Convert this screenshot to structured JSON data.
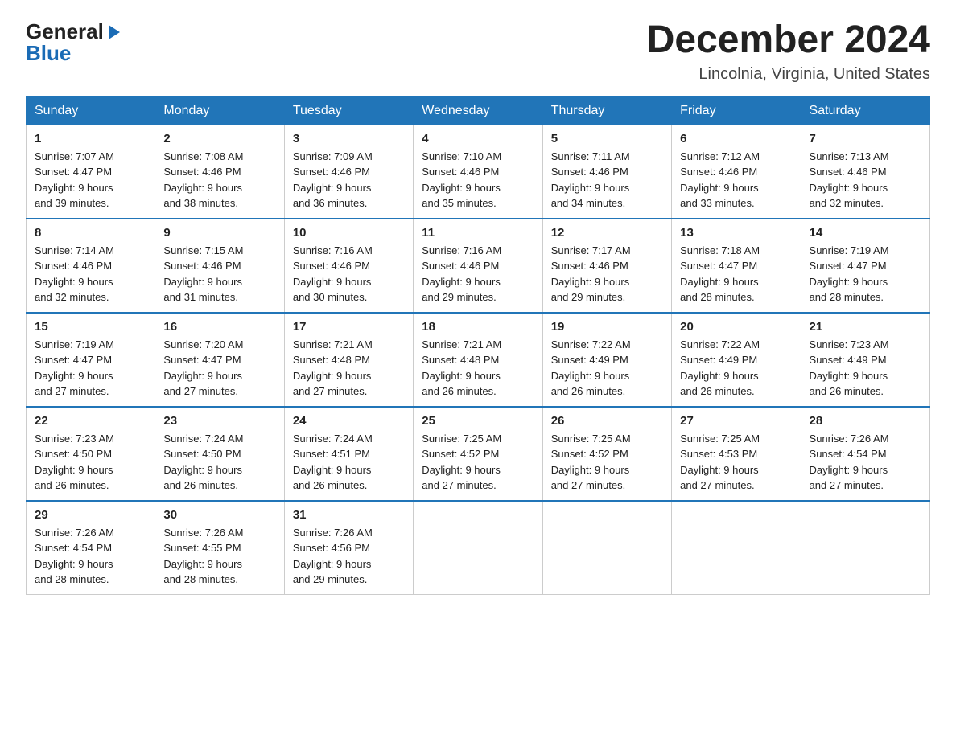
{
  "logo": {
    "text_general": "General",
    "text_blue": "Blue",
    "arrow": "▶"
  },
  "title": {
    "month_year": "December 2024",
    "location": "Lincolnia, Virginia, United States"
  },
  "days_of_week": [
    "Sunday",
    "Monday",
    "Tuesday",
    "Wednesday",
    "Thursday",
    "Friday",
    "Saturday"
  ],
  "weeks": [
    [
      {
        "num": "1",
        "sunrise": "7:07 AM",
        "sunset": "4:47 PM",
        "daylight": "9 hours and 39 minutes."
      },
      {
        "num": "2",
        "sunrise": "7:08 AM",
        "sunset": "4:46 PM",
        "daylight": "9 hours and 38 minutes."
      },
      {
        "num": "3",
        "sunrise": "7:09 AM",
        "sunset": "4:46 PM",
        "daylight": "9 hours and 36 minutes."
      },
      {
        "num": "4",
        "sunrise": "7:10 AM",
        "sunset": "4:46 PM",
        "daylight": "9 hours and 35 minutes."
      },
      {
        "num": "5",
        "sunrise": "7:11 AM",
        "sunset": "4:46 PM",
        "daylight": "9 hours and 34 minutes."
      },
      {
        "num": "6",
        "sunrise": "7:12 AM",
        "sunset": "4:46 PM",
        "daylight": "9 hours and 33 minutes."
      },
      {
        "num": "7",
        "sunrise": "7:13 AM",
        "sunset": "4:46 PM",
        "daylight": "9 hours and 32 minutes."
      }
    ],
    [
      {
        "num": "8",
        "sunrise": "7:14 AM",
        "sunset": "4:46 PM",
        "daylight": "9 hours and 32 minutes."
      },
      {
        "num": "9",
        "sunrise": "7:15 AM",
        "sunset": "4:46 PM",
        "daylight": "9 hours and 31 minutes."
      },
      {
        "num": "10",
        "sunrise": "7:16 AM",
        "sunset": "4:46 PM",
        "daylight": "9 hours and 30 minutes."
      },
      {
        "num": "11",
        "sunrise": "7:16 AM",
        "sunset": "4:46 PM",
        "daylight": "9 hours and 29 minutes."
      },
      {
        "num": "12",
        "sunrise": "7:17 AM",
        "sunset": "4:46 PM",
        "daylight": "9 hours and 29 minutes."
      },
      {
        "num": "13",
        "sunrise": "7:18 AM",
        "sunset": "4:47 PM",
        "daylight": "9 hours and 28 minutes."
      },
      {
        "num": "14",
        "sunrise": "7:19 AM",
        "sunset": "4:47 PM",
        "daylight": "9 hours and 28 minutes."
      }
    ],
    [
      {
        "num": "15",
        "sunrise": "7:19 AM",
        "sunset": "4:47 PM",
        "daylight": "9 hours and 27 minutes."
      },
      {
        "num": "16",
        "sunrise": "7:20 AM",
        "sunset": "4:47 PM",
        "daylight": "9 hours and 27 minutes."
      },
      {
        "num": "17",
        "sunrise": "7:21 AM",
        "sunset": "4:48 PM",
        "daylight": "9 hours and 27 minutes."
      },
      {
        "num": "18",
        "sunrise": "7:21 AM",
        "sunset": "4:48 PM",
        "daylight": "9 hours and 26 minutes."
      },
      {
        "num": "19",
        "sunrise": "7:22 AM",
        "sunset": "4:49 PM",
        "daylight": "9 hours and 26 minutes."
      },
      {
        "num": "20",
        "sunrise": "7:22 AM",
        "sunset": "4:49 PM",
        "daylight": "9 hours and 26 minutes."
      },
      {
        "num": "21",
        "sunrise": "7:23 AM",
        "sunset": "4:49 PM",
        "daylight": "9 hours and 26 minutes."
      }
    ],
    [
      {
        "num": "22",
        "sunrise": "7:23 AM",
        "sunset": "4:50 PM",
        "daylight": "9 hours and 26 minutes."
      },
      {
        "num": "23",
        "sunrise": "7:24 AM",
        "sunset": "4:50 PM",
        "daylight": "9 hours and 26 minutes."
      },
      {
        "num": "24",
        "sunrise": "7:24 AM",
        "sunset": "4:51 PM",
        "daylight": "9 hours and 26 minutes."
      },
      {
        "num": "25",
        "sunrise": "7:25 AM",
        "sunset": "4:52 PM",
        "daylight": "9 hours and 27 minutes."
      },
      {
        "num": "26",
        "sunrise": "7:25 AM",
        "sunset": "4:52 PM",
        "daylight": "9 hours and 27 minutes."
      },
      {
        "num": "27",
        "sunrise": "7:25 AM",
        "sunset": "4:53 PM",
        "daylight": "9 hours and 27 minutes."
      },
      {
        "num": "28",
        "sunrise": "7:26 AM",
        "sunset": "4:54 PM",
        "daylight": "9 hours and 27 minutes."
      }
    ],
    [
      {
        "num": "29",
        "sunrise": "7:26 AM",
        "sunset": "4:54 PM",
        "daylight": "9 hours and 28 minutes."
      },
      {
        "num": "30",
        "sunrise": "7:26 AM",
        "sunset": "4:55 PM",
        "daylight": "9 hours and 28 minutes."
      },
      {
        "num": "31",
        "sunrise": "7:26 AM",
        "sunset": "4:56 PM",
        "daylight": "9 hours and 29 minutes."
      },
      null,
      null,
      null,
      null
    ]
  ],
  "labels": {
    "sunrise": "Sunrise:",
    "sunset": "Sunset:",
    "daylight": "Daylight:"
  }
}
